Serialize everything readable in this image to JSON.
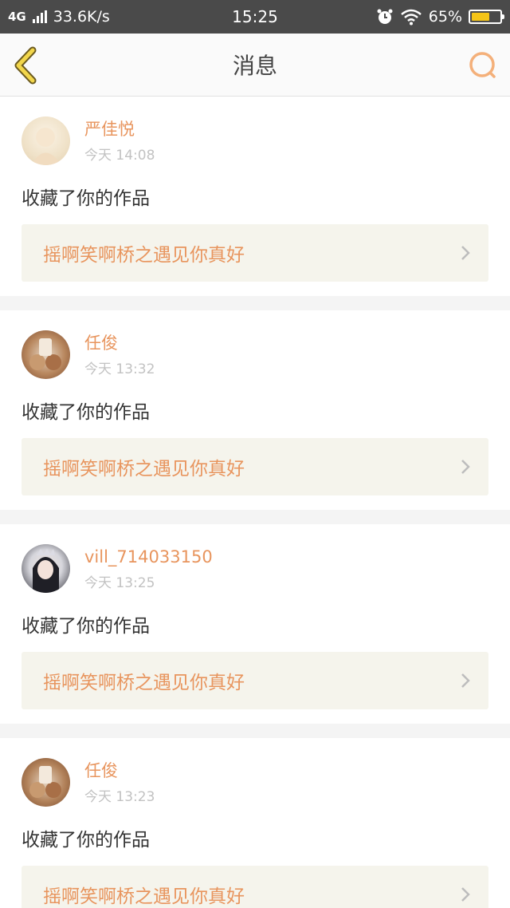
{
  "status_bar": {
    "network": "4G",
    "speed": "33.6K/s",
    "time": "15:25",
    "battery": "65%",
    "battery_level": 0.65,
    "battery_color": "#f5c518"
  },
  "header": {
    "title": "消息",
    "back_icon": "chevron-left-icon",
    "search_icon": "search-icon",
    "accent_color": "#e8955e"
  },
  "messages": [
    {
      "user": "严佳悦",
      "time": "今天 14:08",
      "action": "收藏了你的作品",
      "work_title": "摇啊笑啊桥之遇见你真好"
    },
    {
      "user": "任俊",
      "time": "今天 13:32",
      "action": "收藏了你的作品",
      "work_title": "摇啊笑啊桥之遇见你真好"
    },
    {
      "user": "vill_714033150",
      "time": "今天 13:25",
      "action": "收藏了你的作品",
      "work_title": "摇啊笑啊桥之遇见你真好"
    },
    {
      "user": "任俊",
      "time": "今天 13:23",
      "action": "收藏了你的作品",
      "work_title": "摇啊笑啊桥之遇见你真好"
    }
  ]
}
